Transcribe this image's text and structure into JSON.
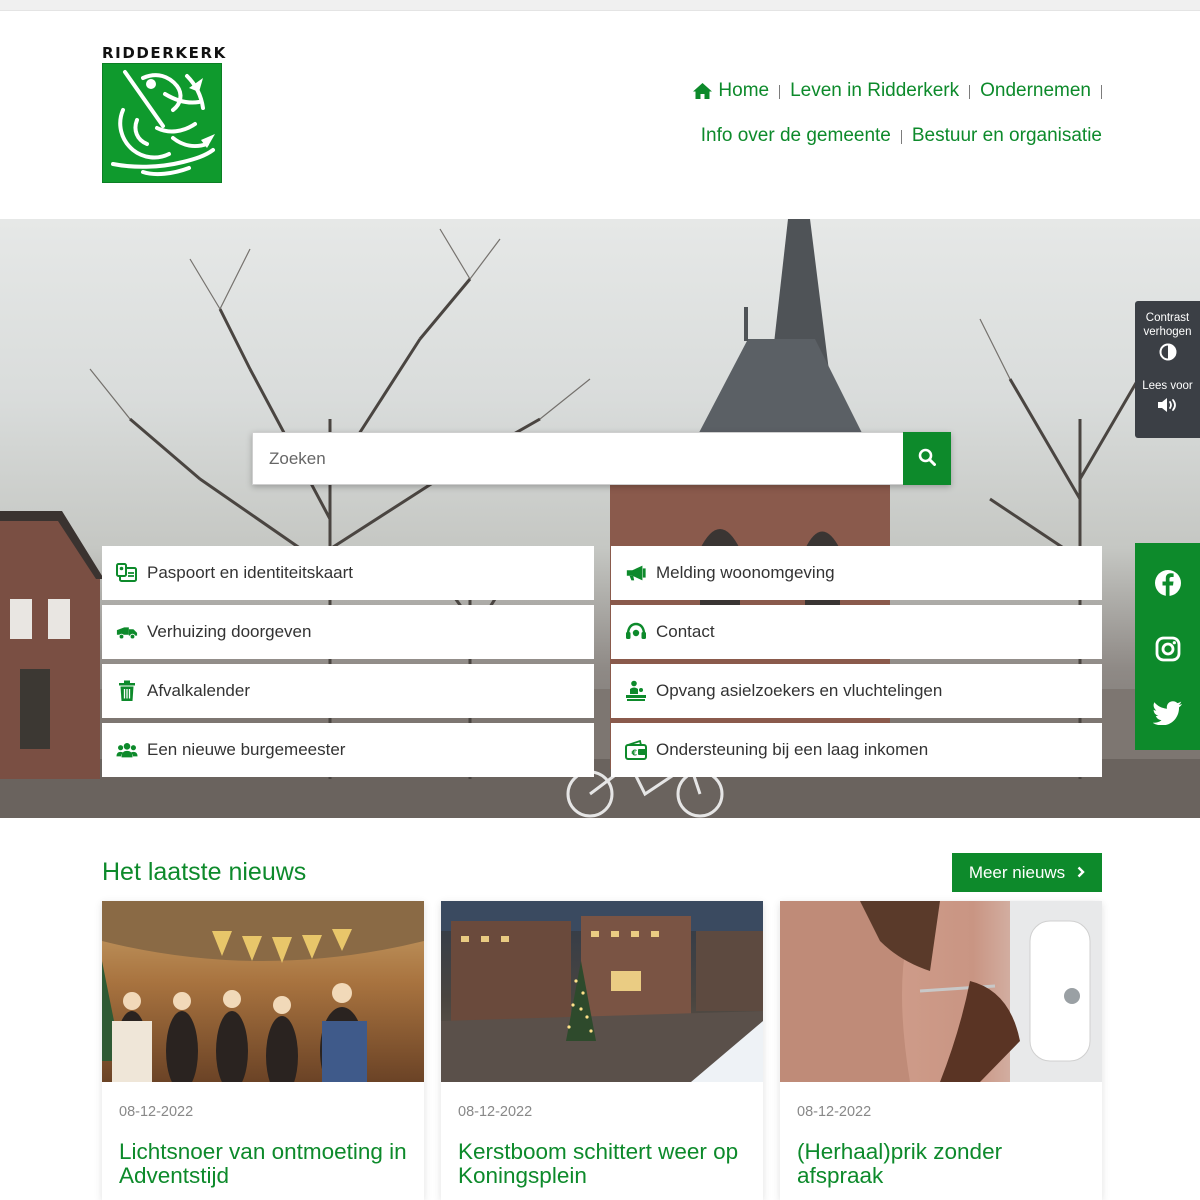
{
  "brand": {
    "logo_text": "RIDDERKERK",
    "green": "#0d8a2b",
    "dark": "#3b3f45"
  },
  "nav": [
    {
      "label": "Home",
      "icon": "home-icon"
    },
    {
      "label": "Leven in Ridderkerk"
    },
    {
      "label": "Ondernemen"
    },
    {
      "label": "Info over de gemeente"
    },
    {
      "label": "Bestuur en organisatie"
    }
  ],
  "search": {
    "placeholder": "Zoeken",
    "button_icon": "search-icon"
  },
  "tiles": [
    {
      "label": "Paspoort en identiteitskaart",
      "icon": "id-card-icon"
    },
    {
      "label": "Melding woonomgeving",
      "icon": "megaphone-icon"
    },
    {
      "label": "Verhuizing doorgeven",
      "icon": "moving-truck-icon"
    },
    {
      "label": "Contact",
      "icon": "headset-icon"
    },
    {
      "label": "Afvalkalender",
      "icon": "trash-icon"
    },
    {
      "label": "Opvang asielzoekers en vluchtelingen",
      "icon": "people-shelter-icon"
    },
    {
      "label": "Een nieuwe burgemeester",
      "icon": "users-icon"
    },
    {
      "label": "Ondersteuning bij een laag inkomen",
      "icon": "wallet-euro-icon"
    }
  ],
  "accessibility": {
    "contrast_label": "Contrast verhogen",
    "read_label": "Lees voor"
  },
  "social": [
    "facebook-icon",
    "instagram-icon",
    "twitter-icon"
  ],
  "news": {
    "title": "Het laatste nieuws",
    "more_label": "Meer nieuws",
    "items": [
      {
        "date": "08-12-2022",
        "title": "Lichtsnoer van ontmoeting in Adventstijd"
      },
      {
        "date": "08-12-2022",
        "title": "Kerstboom schittert weer op Koningsplein"
      },
      {
        "date": "08-12-2022",
        "title": "(Herhaal)prik zonder afspraak"
      }
    ]
  }
}
